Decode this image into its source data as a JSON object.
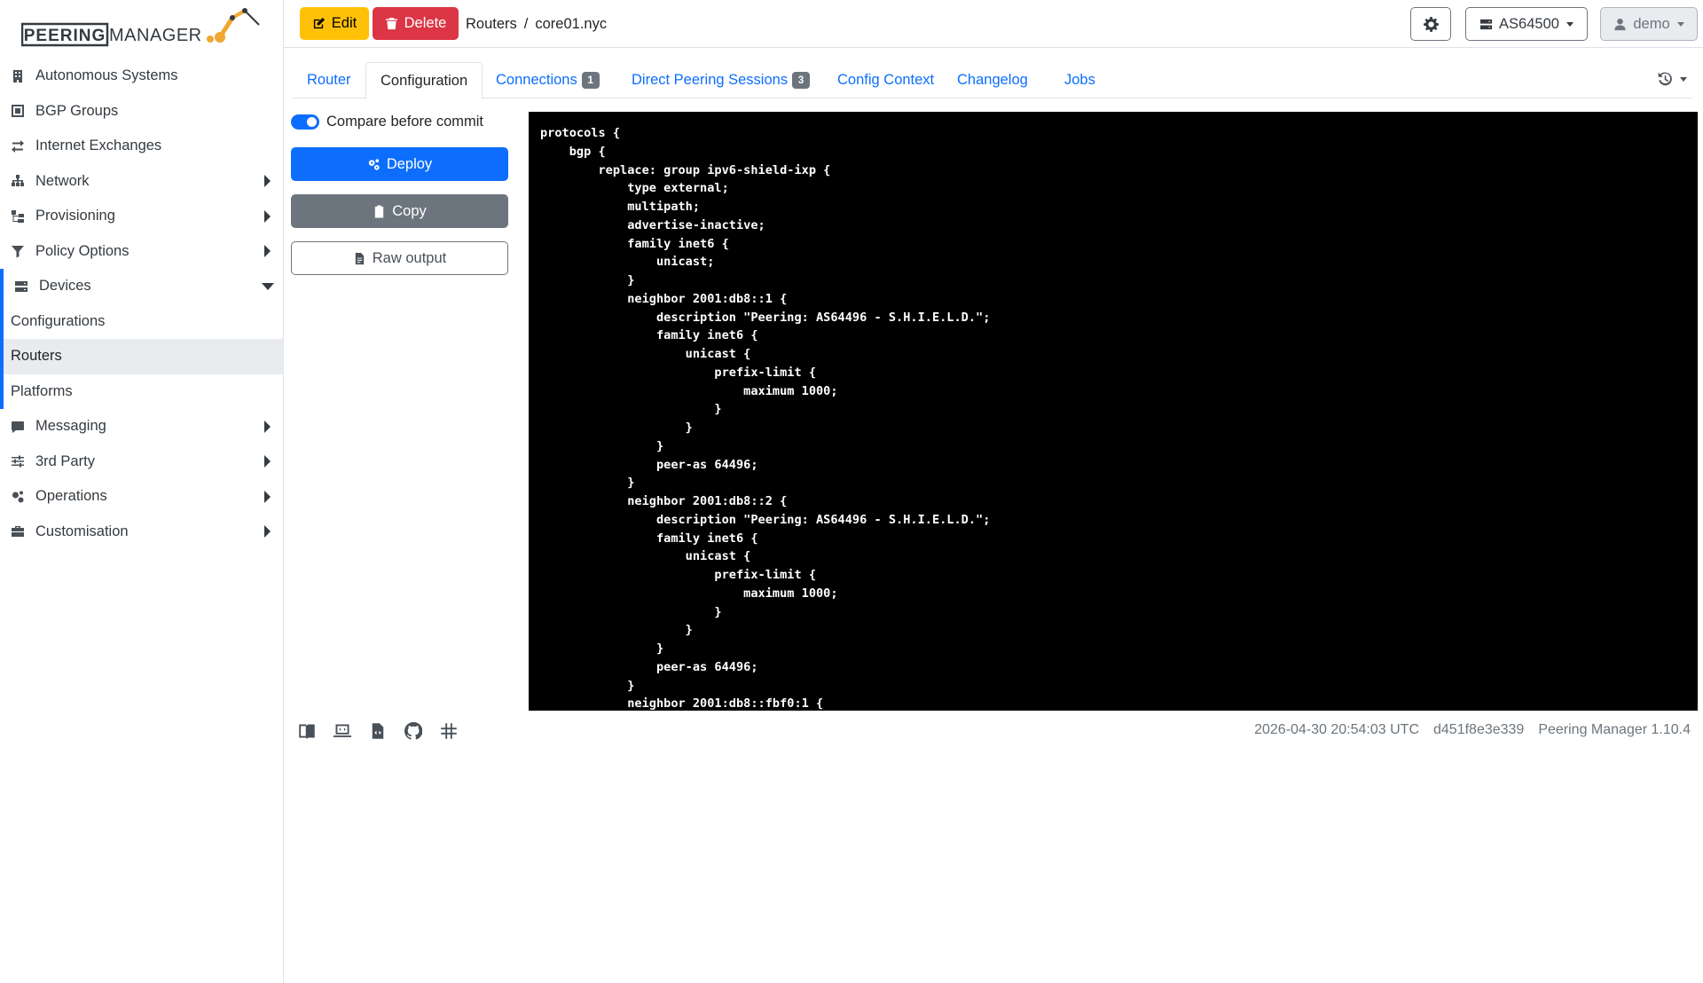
{
  "brand": {
    "name_left": "PEERING",
    "name_right": "MANAGER"
  },
  "sidebar": {
    "items": [
      {
        "label": "Autonomous Systems",
        "icon": "building-icon"
      },
      {
        "label": "BGP Groups",
        "icon": "group-icon"
      },
      {
        "label": "Internet Exchanges",
        "icon": "exchange-icon"
      },
      {
        "label": "Network",
        "icon": "network-icon"
      },
      {
        "label": "Provisioning",
        "icon": "provisioning-icon"
      },
      {
        "label": "Policy Options",
        "icon": "filter-icon"
      }
    ],
    "devices": {
      "label": "Devices",
      "icon": "server-icon",
      "children": [
        "Configurations",
        "Routers",
        "Platforms"
      ]
    },
    "items_after": [
      {
        "label": "Messaging",
        "icon": "chat-icon"
      },
      {
        "label": "3rd Party",
        "icon": "sliders-icon"
      },
      {
        "label": "Operations",
        "icon": "cogs-icon"
      },
      {
        "label": "Customisation",
        "icon": "toolbox-icon"
      }
    ]
  },
  "header": {
    "edit_label": "Edit",
    "delete_label": "Delete",
    "breadcrumb": {
      "parent": "Routers",
      "separator": "/",
      "current": "core01.nyc"
    },
    "asn_label": "AS64500",
    "user_label": "demo"
  },
  "tabs": [
    {
      "label": "Router"
    },
    {
      "label": "Configuration"
    },
    {
      "label": "Connections",
      "badge": "1"
    },
    {
      "label": "Direct Peering Sessions",
      "badge": "3"
    },
    {
      "label": "Config Context"
    },
    {
      "label": "Changelog"
    },
    {
      "label": "Jobs"
    }
  ],
  "controls": {
    "compare_label": "Compare before commit",
    "deploy_label": "Deploy",
    "copy_label": "Copy",
    "raw_label": "Raw output"
  },
  "config_text": "protocols {\n    bgp {\n        replace: group ipv6-shield-ixp {\n            type external;\n            multipath;\n            advertise-inactive;\n            family inet6 {\n                unicast;\n            }\n            neighbor 2001:db8::1 {\n                description \"Peering: AS64496 - S.H.I.E.L.D.\";\n                family inet6 {\n                    unicast {\n                        prefix-limit {\n                            maximum 1000;\n                        }\n                    }\n                }\n                peer-as 64496;\n            }\n            neighbor 2001:db8::2 {\n                description \"Peering: AS64496 - S.H.I.E.L.D.\";\n                family inet6 {\n                    unicast {\n                        prefix-limit {\n                            maximum 1000;\n                        }\n                    }\n                }\n                peer-as 64496;\n            }\n            neighbor 2001:db8::fbf0:1 {",
  "footer": {
    "timestamp": "2026-04-30 20:54:03 UTC",
    "commit": "d451f8e3e339",
    "version": "Peering Manager 1.10.4"
  }
}
